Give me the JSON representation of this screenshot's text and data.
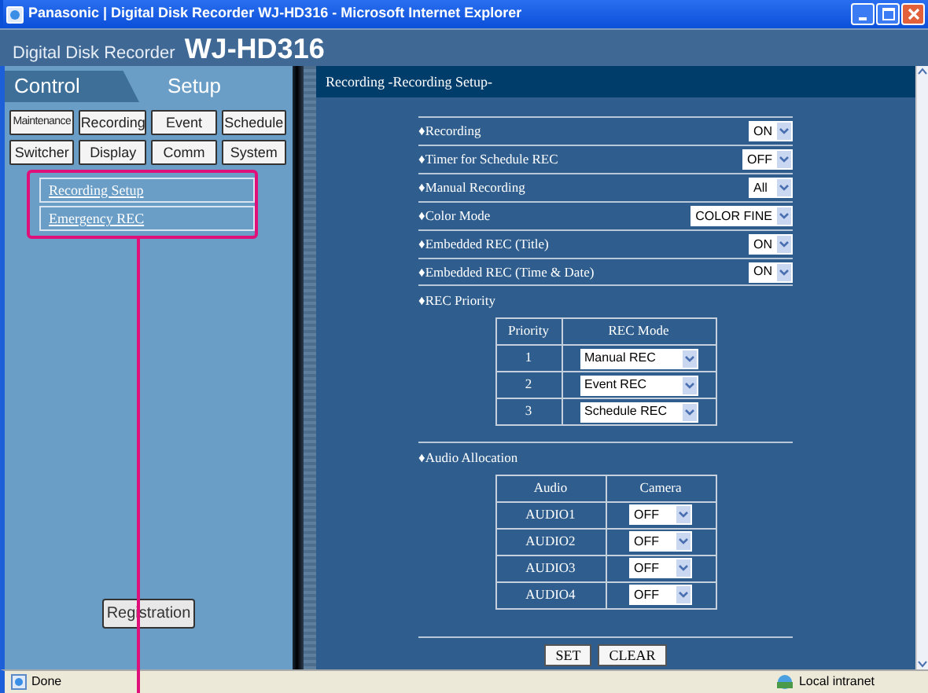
{
  "window": {
    "title": "Panasonic | Digital Disk Recorder WJ-HD316 - Microsoft Internet Explorer"
  },
  "header": {
    "product": "Digital Disk Recorder",
    "model": "WJ-HD316"
  },
  "tabs": [
    {
      "label": "Control",
      "selected": false
    },
    {
      "label": "Setup",
      "selected": true
    }
  ],
  "menu_buttons": [
    "Maintenance",
    "Recording",
    "Event",
    "Schedule",
    "Switcher",
    "Display",
    "Comm",
    "System"
  ],
  "submenu": [
    "Recording Setup",
    "Emergency REC"
  ],
  "registration_button": "Registration",
  "page_title": "Recording -Recording Setup-",
  "settings": [
    {
      "label": "♦Recording",
      "value": "ON"
    },
    {
      "label": "♦Timer for Schedule REC",
      "value": "OFF"
    },
    {
      "label": "♦Manual Recording",
      "value": "All"
    },
    {
      "label": "♦Color Mode",
      "value": "COLOR FINE"
    },
    {
      "label": "♦Embedded REC (Title)",
      "value": "ON"
    },
    {
      "label": "♦Embedded REC (Time & Date)",
      "value": "ON"
    }
  ],
  "rec_priority": {
    "label": "♦REC Priority",
    "columns": [
      "Priority",
      "REC Mode"
    ],
    "rows": [
      {
        "priority": "1",
        "mode": "Manual REC"
      },
      {
        "priority": "2",
        "mode": "Event REC"
      },
      {
        "priority": "3",
        "mode": "Schedule REC"
      }
    ]
  },
  "audio_allocation": {
    "label": "♦Audio Allocation",
    "columns": [
      "Audio",
      "Camera"
    ],
    "rows": [
      {
        "audio": "AUDIO1",
        "camera": "OFF"
      },
      {
        "audio": "AUDIO2",
        "camera": "OFF"
      },
      {
        "audio": "AUDIO3",
        "camera": "OFF"
      },
      {
        "audio": "AUDIO4",
        "camera": "OFF"
      }
    ]
  },
  "buttons": [
    "SET",
    "CLEAR"
  ],
  "status_bar": {
    "text": "Done",
    "zone": "Local intranet"
  }
}
